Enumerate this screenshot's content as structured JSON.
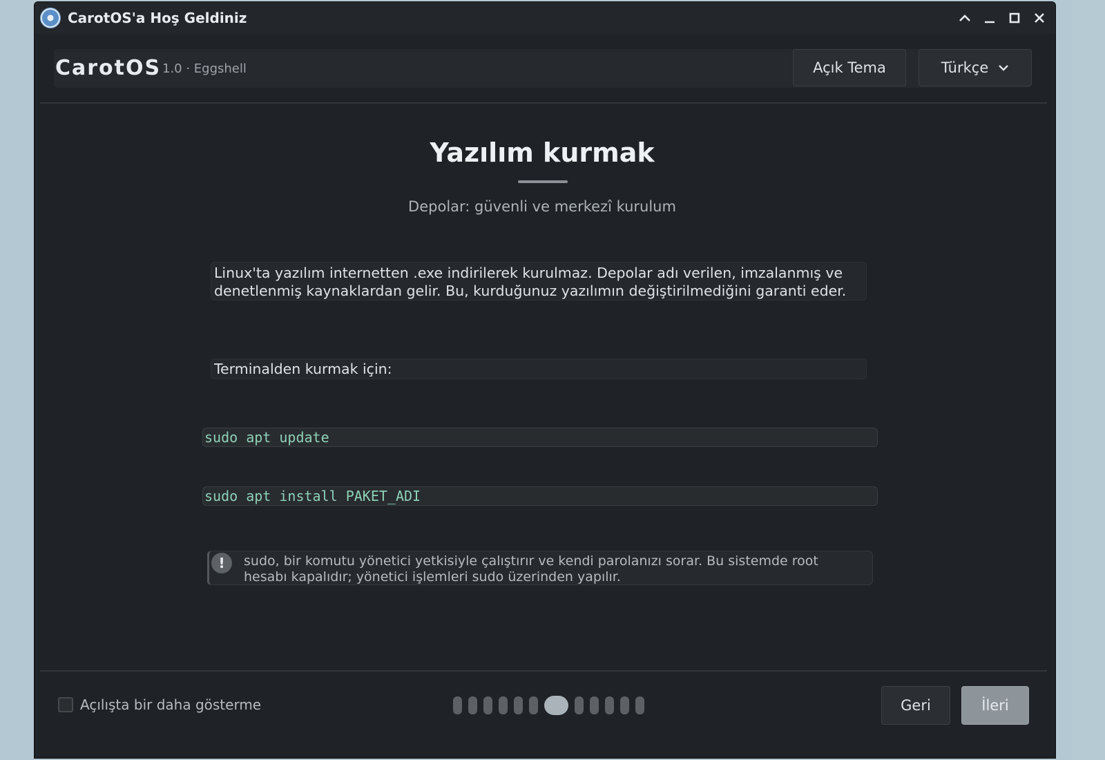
{
  "window": {
    "title": "CarotOS'a Hoş Geldiniz"
  },
  "header": {
    "brand": "CarotOS",
    "version": "1.0 · Eggshell",
    "theme_button": "Açık Tema",
    "language_button": "Türkçe"
  },
  "page": {
    "title": "Yazılım kurmak",
    "subtitle": "Depolar: güvenli ve merkezî kurulum",
    "intro": "Linux'ta yazılım internetten .exe indirilerek kurulmaz. Depolar adı verilen, imzalanmış ve denetlenmiş kaynaklardan gelir. Bu, kurduğunuz yazılımın değiştirilmediğini garanti eder.",
    "terminal_label": "Terminalden kurmak için:",
    "commands": [
      "sudo apt update",
      "sudo apt install PAKET_ADI"
    ],
    "note_icon": "!",
    "note": "sudo, bir komutu yönetici yetkisiyle çalıştırır ve kendi parolanızı sorar. Bu sistemde root hesabı kapalıdır; yönetici işlemleri sudo üzerinden yapılır."
  },
  "footer": {
    "checkbox_label": "Açılışta bir daha gösterme",
    "checkbox_checked": false,
    "back_button": "Geri",
    "next_button": "İleri",
    "pages_total": 12,
    "current_page": 7
  },
  "colors": {
    "window_bg": "#1f2226",
    "accent_code": "#8fd1b7",
    "next_button_bg": "#8d959b"
  }
}
